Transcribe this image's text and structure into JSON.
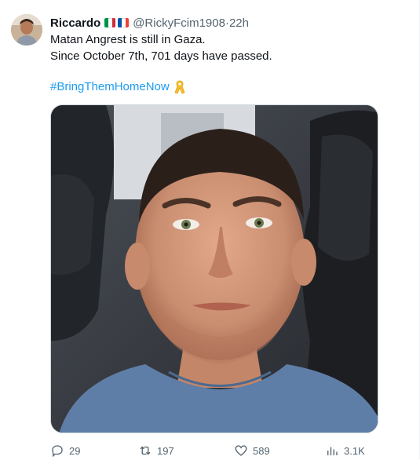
{
  "author": {
    "name": "Riccardo",
    "handle": "@RickyFcim1908",
    "time": "22h",
    "flags": [
      "italy-flag",
      "france-flag"
    ]
  },
  "tweet": {
    "line1": "Matan Angrest is still in Gaza.",
    "line2": "Since October 7th, 701 days have passed.",
    "hashtag": "#BringThemHomeNow",
    "ribbon_icon": "yellow-ribbon-icon"
  },
  "actions": {
    "replies": "29",
    "retweets": "197",
    "likes": "589",
    "views": "3.1K"
  },
  "colors": {
    "link": "#1d9bf0",
    "muted": "#536471",
    "ribbon": "#f7c02b"
  }
}
